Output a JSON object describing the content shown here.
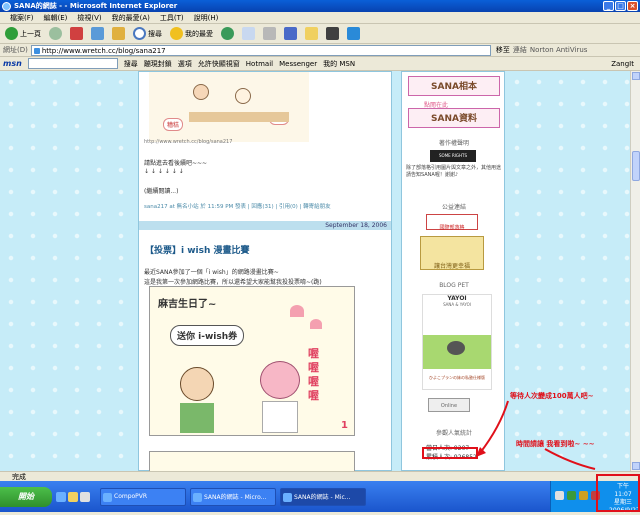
{
  "window": {
    "title": "SANA的網誌 - - Microsoft Internet Explorer"
  },
  "menu": [
    "檔案(F)",
    "編輯(E)",
    "檢視(V)",
    "我的最愛(A)",
    "工具(T)",
    "說明(H)"
  ],
  "toolbar": {
    "back": "上一頁",
    "search": "搜尋",
    "favorites": "我的最愛"
  },
  "address": {
    "label": "網址(D)",
    "url": "http://www.wretch.cc/blog/sana217",
    "go": "移至",
    "links": "連結",
    "norton": "Norton AntiVirus"
  },
  "msn": {
    "logo": "msn",
    "search": "搜尋",
    "popup": "蹦現封鎖",
    "options": "選項",
    "bookmarks": "允許快顯視窗",
    "hotmail": "Hotmail",
    "messenger": "Messenger",
    "mymsn": "我的 MSN",
    "zangit": "ZangIt"
  },
  "post1": {
    "bubble1": "糟糕",
    "bubble2": "睡覺",
    "source": "http://www.wretch.cc/blog/sana217",
    "line1": "請點進去看後續吧~~~",
    "arrows": "↓        ↓        ↓        ↓        ↓        ↓",
    "readmore": "(繼續閱讀...)",
    "meta": "sana217 at 無名小站 於 11:59 PM 發表 | 回應(31) | 引用(0) | 轉寄給朋友"
  },
  "post2": {
    "date": "September 18, 2006",
    "title": "【投票】i wish 漫畫比賽",
    "line1": "最近SANA參加了一個「i wish」的網路漫畫比賽~",
    "line2": "這是我第一次參加網路比賽，所以還希望大家能幫我投投票唷~(跪)",
    "comic_title": "麻吉生日了~",
    "comic_bubble": "送你 i-wish券",
    "comic_sfx": "喔喔喔喔",
    "comic_num": "1"
  },
  "sidebar": {
    "banner1": "SANA相本",
    "banner2": "SANA資料",
    "banner_small": "點閱在此",
    "copyright_heading": "著作權聲明",
    "copyright_text": "除了部落格引用圖片與文章之外，其他用途請告知SANA喔！謝謝♪",
    "cc_label": "SOME RIGHTS RESERVED",
    "links_heading": "公益連結",
    "link1": "國際部落格",
    "link2": "讓台灣更幸福",
    "pet_heading": "BLOG PET",
    "pet_name": "YAYOI",
    "pet_sub": "SANA & YAYOI",
    "pet_caption": "ひよこプランの妹の私塾仕様版",
    "online_label": "Online",
    "visitor_heading": "參觀人氣統計",
    "today_visits": "當日人次: 9207",
    "total_visits": "累積人次: 926852"
  },
  "annotations": {
    "note1": "等待人次變成100萬人吧~",
    "note2": "時間請讓 我看到啦~ ~~"
  },
  "status": {
    "text": "完成"
  },
  "taskbar": {
    "start": "開始",
    "items": [
      "CompoPVR",
      "SANA的網誌 - Micro...",
      "SANA的網誌 - Mic..."
    ],
    "time": "下午 11:07",
    "weekday": "星期三",
    "date": "2006/9/27"
  },
  "colors": {
    "accent_red": "#e0101a",
    "page_bg": "#c6ecf8",
    "title_blue": "#1d5a8a"
  }
}
